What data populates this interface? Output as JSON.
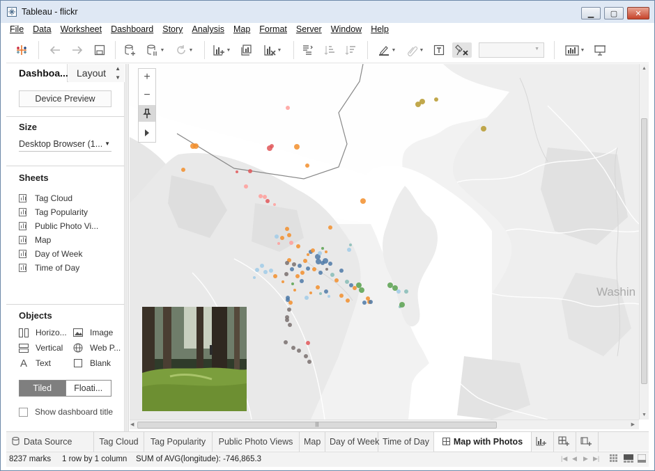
{
  "window": {
    "title": "Tableau - flickr",
    "controls": {
      "minimize": "▁",
      "maximize": "▢",
      "close": "✕"
    }
  },
  "menu": [
    "File",
    "Data",
    "Worksheet",
    "Dashboard",
    "Story",
    "Analysis",
    "Map",
    "Format",
    "Server",
    "Window",
    "Help"
  ],
  "toolbar": {
    "icons": [
      "tableau-logo-icon",
      "undo-icon",
      "redo-icon",
      "save-icon",
      "new-data-source-icon",
      "pause-updates-icon",
      "refresh-icon",
      "new-worksheet-icon",
      "duplicate-sheet-icon",
      "clear-sheet-icon",
      "swap-icon",
      "sort-ascending-icon",
      "sort-descending-icon",
      "highlight-icon",
      "group-icon",
      "show-labels-icon",
      "fix-axes-icon",
      "show-me-icon",
      "presentation-icon"
    ]
  },
  "left_panel": {
    "tabs": {
      "dashboard": "Dashboa...",
      "layout": "Layout"
    },
    "device_preview": "Device Preview",
    "size": {
      "title": "Size",
      "value": "Desktop Browser (1..."
    },
    "sheets": {
      "title": "Sheets",
      "items": [
        "Tag Cloud",
        "Tag Popularity",
        "Public Photo Vi...",
        "Map",
        "Day of Week",
        "Time of Day"
      ]
    },
    "objects": {
      "title": "Objects",
      "items": [
        {
          "label": "Horizo...",
          "icon": "horizontal-container-icon"
        },
        {
          "label": "Image",
          "icon": "image-icon"
        },
        {
          "label": "Vertical",
          "icon": "vertical-container-icon"
        },
        {
          "label": "Web P...",
          "icon": "globe-icon"
        },
        {
          "label": "Text",
          "icon": "text-icon"
        },
        {
          "label": "Blank",
          "icon": "blank-icon"
        }
      ]
    },
    "layout_toggle": {
      "tiled": "Tiled",
      "floating": "Floati..."
    },
    "show_title": "Show dashboard title"
  },
  "map": {
    "label": "Washin",
    "controls": {
      "zoom_in": "+",
      "zoom_out": "−"
    }
  },
  "sheet_tabs": {
    "data_source": "Data Source",
    "tabs": [
      "Tag Cloud",
      "Tag Popularity",
      "Public Photo Views",
      "Map",
      "Day of Week",
      "Time of Day",
      "Map with Photos"
    ],
    "active": "Map with Photos"
  },
  "status": {
    "marks": "8237 marks",
    "rows": "1 row by 1 column",
    "sum": "SUM of AVG(longitude): -746,865.3"
  },
  "colors": {
    "orange": "#f28e2b",
    "blue": "#4e79a7",
    "light_blue": "#a0cbe8",
    "green": "#59a14f",
    "red": "#e15759",
    "pink": "#ff9d9a",
    "gray": "#79706e",
    "olive": "#b6992d",
    "teal": "#86bcb6"
  }
}
